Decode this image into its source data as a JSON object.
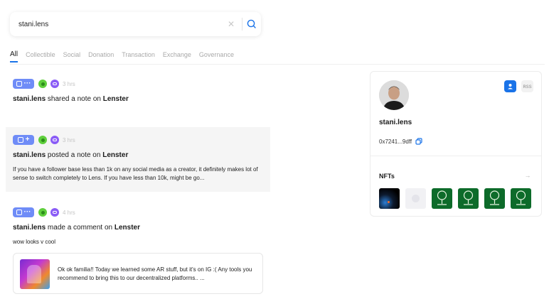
{
  "search": {
    "value": "stani.lens",
    "clear_label": "✕"
  },
  "tabs": [
    {
      "label": "All",
      "active": true
    },
    {
      "label": "Collectible",
      "active": false
    },
    {
      "label": "Social",
      "active": false
    },
    {
      "label": "Donation",
      "active": false
    },
    {
      "label": "Transaction",
      "active": false
    },
    {
      "label": "Exchange",
      "active": false
    },
    {
      "label": "Governance",
      "active": false
    }
  ],
  "feed": [
    {
      "pill_symbol": "···",
      "time": "3 hrs",
      "actor": "stani.lens",
      "action": "shared a note on",
      "platform": "Lenster"
    },
    {
      "pill_symbol": "+",
      "time": "3 hrs",
      "actor": "stani.lens",
      "action": "posted a note on",
      "platform": "Lenster",
      "body": "If you have a follower base less than 1k on any social media as a creator, it definitely makes lot of sense to switch completely to Lens. If you have less than 10k, might be go..."
    },
    {
      "pill_symbol": "···",
      "time": "4 hrs",
      "actor": "stani.lens",
      "action": "made a comment on",
      "platform": "Lenster",
      "body": "wow looks v cool",
      "quote": "Ok ok familia!! Today we learned some AR stuff, but it's on IG :( Any tools you recommend  to bring this to our decentralized platforms.. ..."
    }
  ],
  "profile": {
    "name": "stani.lens",
    "address": "0x7241...9dff",
    "rss_label": "ʀss",
    "nfts_title": "NFTs",
    "nfts_arrow": "→",
    "accent": "#1a73e8"
  },
  "icons": [
    "search-icon",
    "close-icon",
    "note-icon",
    "lens-icon",
    "link-icon",
    "follow-icon",
    "rss-icon",
    "copy-icon",
    "arrow-right-icon"
  ]
}
